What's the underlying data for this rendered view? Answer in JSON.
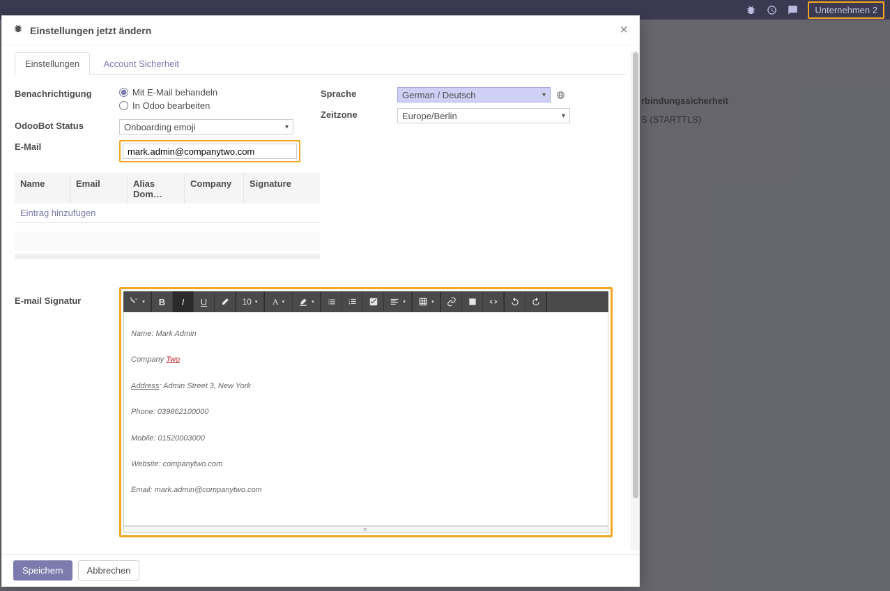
{
  "header": {
    "company_label": "Unternehmen 2"
  },
  "background": {
    "col_label": "rbindungssicherheit",
    "col_value": "S (STARTTLS)"
  },
  "dialog": {
    "title": "Einstellungen jetzt ändern",
    "tabs": [
      "Einstellungen",
      "Account Sicherheit"
    ],
    "fields": {
      "notification_label": "Benachrichtigung",
      "notif_opt_email": "Mit E-Mail behandeln",
      "notif_opt_odoo": "In Odoo bearbeiten",
      "odoobot_label": "OdooBot Status",
      "odoobot_value": "Onboarding emoji",
      "email_label": "E-Mail",
      "email_value": "mark.admin@companytwo.com",
      "language_label": "Sprache",
      "language_value": "German / Deutsch",
      "tz_label": "Zeitzone",
      "tz_value": "Europe/Berlin"
    },
    "table": {
      "cols": [
        "Name",
        "Email",
        "Alias Dom…",
        "Company",
        "Signature"
      ],
      "add_label": "Eintrag hinzufügen"
    },
    "signature": {
      "label": "E-mail Signatur",
      "fontsize": "10",
      "lines": {
        "name": "Name: Mark Admin",
        "company_prefix": "Company",
        "company_value": "Two",
        "address_prefix": "Address",
        "address_rest": ": Admin Street 3, New York",
        "phone": "Phone: 039862100000",
        "mobile": "Mobile: 01520003000",
        "website": "Website: companytwo.com",
        "email": "Email: mark.admin@companytwo.com"
      }
    },
    "buttons": {
      "save": "Speichern",
      "cancel": "Abbrechen"
    }
  }
}
